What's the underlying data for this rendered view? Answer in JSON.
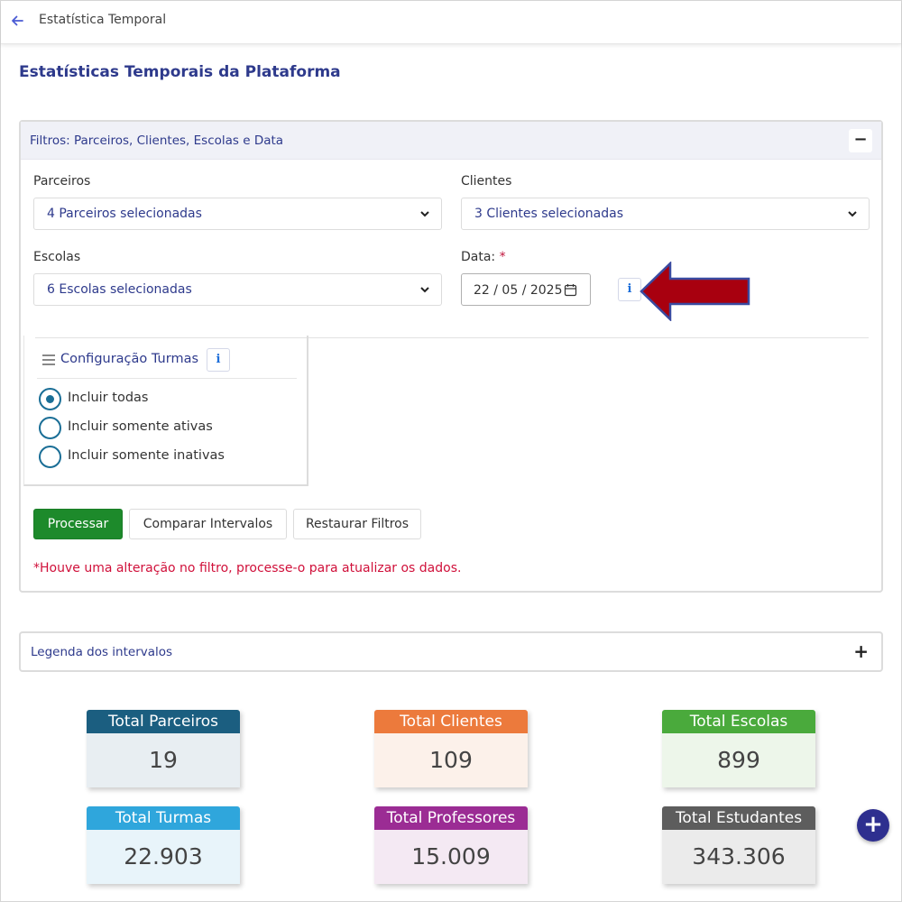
{
  "topbar": {
    "title": "Estatística Temporal"
  },
  "page": {
    "title": "Estatísticas Temporais da Plataforma"
  },
  "filters": {
    "header": "Filtros: Parceiros, Clientes, Escolas e Data",
    "collapse_symbol": "−",
    "parceiros": {
      "label": "Parceiros",
      "value": "4 Parceiros selecionadas"
    },
    "clientes": {
      "label": "Clientes",
      "value": "3 Clientes selecionadas"
    },
    "escolas": {
      "label": "Escolas",
      "value": "6 Escolas selecionadas"
    },
    "data": {
      "label": "Data:",
      "required_mark": "*",
      "value": "22 / 05 / 2025"
    },
    "info_symbol": "i",
    "config": {
      "title": "Configuração Turmas",
      "options": [
        {
          "label": "Incluir todas",
          "checked": true
        },
        {
          "label": "Incluir somente ativas",
          "checked": false
        },
        {
          "label": "Incluir somente inativas",
          "checked": false
        }
      ]
    },
    "buttons": {
      "process": "Processar",
      "compare": "Comparar Intervalos",
      "reset": "Restaurar Filtros"
    },
    "warning": "*Houve uma alteração no filtro, processe-o para atualizar os dados."
  },
  "legend": {
    "title": "Legenda dos intervalos",
    "expand_symbol": "+"
  },
  "stats": [
    {
      "label": "Total Parceiros",
      "value": "19",
      "head_color": "#1b5e80",
      "body_color": "#e8eef2"
    },
    {
      "label": "Total Clientes",
      "value": "109",
      "head_color": "#ec7a3c",
      "body_color": "#fcf1ea"
    },
    {
      "label": "Total Escolas",
      "value": "899",
      "head_color": "#4aaa3c",
      "body_color": "#edf6ea"
    },
    {
      "label": "Total Turmas",
      "value": "22.903",
      "head_color": "#2fa6dc",
      "body_color": "#e8f4fa"
    },
    {
      "label": "Total Professores",
      "value": "15.009",
      "head_color": "#9b2c94",
      "body_color": "#f4e9f3"
    },
    {
      "label": "Total Estudantes",
      "value": "343.306",
      "head_color": "#5d5d5d",
      "body_color": "#ebebeb"
    }
  ],
  "fab": {
    "symbol": "+"
  },
  "colors": {
    "accent": "#2e3a8c",
    "primary_button": "#1d8a2b",
    "warning": "#d0103a",
    "annotation_arrow": "#a8000f"
  }
}
